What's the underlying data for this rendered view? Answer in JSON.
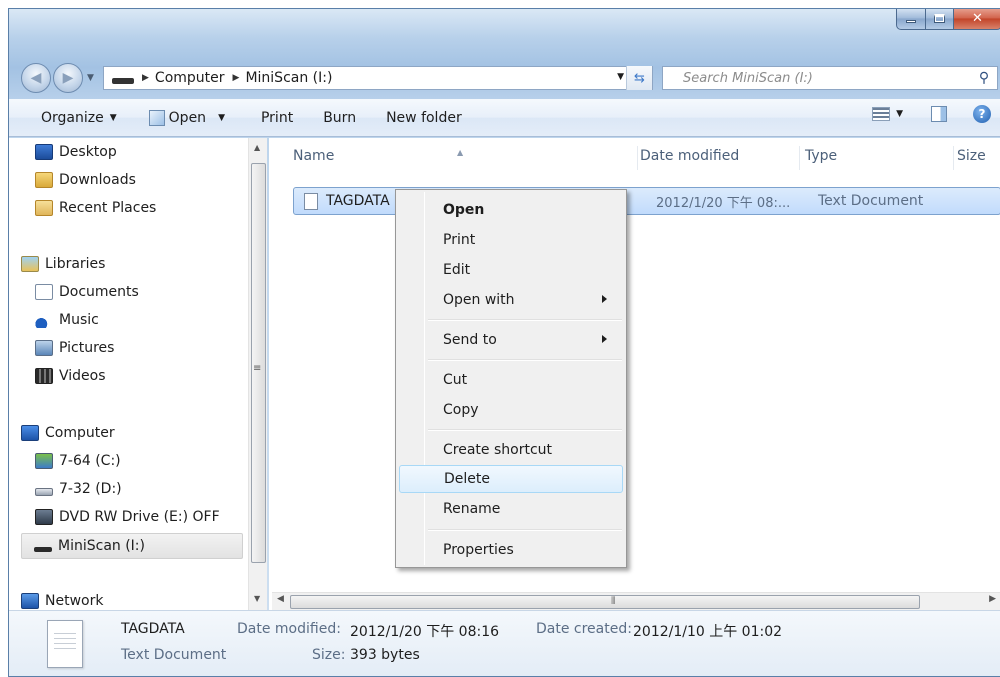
{
  "address": {
    "crumbs": [
      "Computer",
      "MiniScan (I:)"
    ],
    "search_placeholder": "Search MiniScan (I:)"
  },
  "toolbar": {
    "organize": "Organize",
    "open": "Open",
    "print": "Print",
    "burn": "Burn",
    "new_folder": "New folder"
  },
  "navpane": {
    "items": [
      {
        "label": "Desktop",
        "icon": "desktop-icon"
      },
      {
        "label": "Downloads",
        "icon": "downloads-folder-icon"
      },
      {
        "label": "Recent Places",
        "icon": "recent-places-icon"
      },
      {
        "label": "Libraries",
        "icon": "libraries-icon"
      },
      {
        "label": "Documents",
        "icon": "documents-icon"
      },
      {
        "label": "Music",
        "icon": "music-icon"
      },
      {
        "label": "Pictures",
        "icon": "pictures-icon"
      },
      {
        "label": "Videos",
        "icon": "videos-icon"
      },
      {
        "label": "Computer",
        "icon": "computer-icon"
      },
      {
        "label": "7-64 (C:)",
        "icon": "windows-drive-icon"
      },
      {
        "label": "7-32 (D:)",
        "icon": "hard-drive-icon"
      },
      {
        "label": "DVD RW Drive (E:) OFF",
        "icon": "dvd-drive-icon"
      },
      {
        "label": "MiniScan (I:)",
        "icon": "usb-drive-icon",
        "selected": true
      },
      {
        "label": "Network",
        "icon": "network-icon"
      }
    ]
  },
  "columns": [
    "Name",
    "Date modified",
    "Type",
    "Size"
  ],
  "files": [
    {
      "name": "TAGDATA",
      "date_modified": "2012/1/20 下午 08:...",
      "type": "Text Document",
      "selected": true
    }
  ],
  "context_menu": {
    "items": [
      "Open",
      "Print",
      "Edit",
      "Open with",
      "Send to",
      "Cut",
      "Copy",
      "Create shortcut",
      "Delete",
      "Rename",
      "Properties"
    ],
    "default_item": "Open",
    "hovered_item": "Delete"
  },
  "details": {
    "name": "TAGDATA",
    "type": "Text Document",
    "date_modified_label": "Date modified:",
    "date_modified": "2012/1/20 下午 08:16",
    "size_label": "Size:",
    "size": "393 bytes",
    "date_created_label": "Date created:",
    "date_created": "2012/1/10 上午 01:02"
  }
}
